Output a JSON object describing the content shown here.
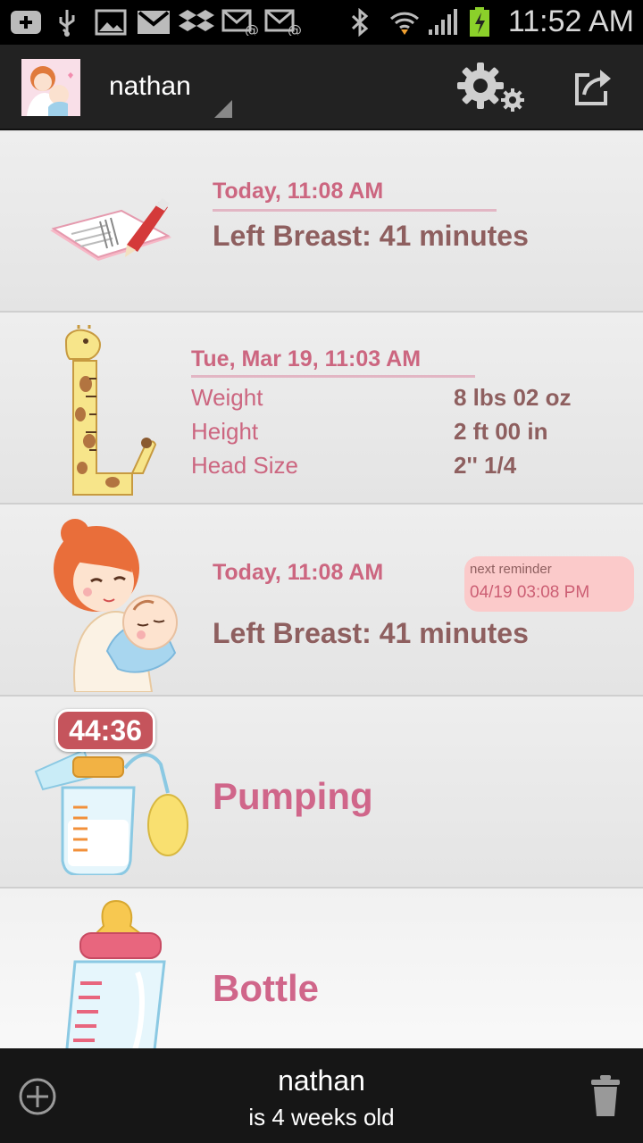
{
  "status_bar": {
    "time": "11:52 AM",
    "icons": [
      "add-notification-icon",
      "usb-icon",
      "image-icon",
      "gmail-icon",
      "dropbox-icon",
      "email-icon",
      "email-icon",
      "bluetooth-icon",
      "wifi-icon",
      "signal-icon",
      "battery-charging-icon"
    ]
  },
  "header": {
    "user_name": "nathan",
    "icons": [
      "avatar-image",
      "settings-gear-icon",
      "share-icon"
    ]
  },
  "entries": [
    {
      "type": "diary",
      "icon": "notebook-pen-icon",
      "date": "Today, 11:08 AM",
      "summary": "Left Breast: 41 minutes"
    },
    {
      "type": "growth",
      "icon": "giraffe-ruler-icon",
      "date": "Tue, Mar 19, 11:03 AM",
      "measurements": [
        {
          "label": "Weight",
          "value": "8 lbs 02 oz"
        },
        {
          "label": "Height",
          "value": "2 ft 00 in"
        },
        {
          "label": "Head Size",
          "value": "2'' 1/4"
        }
      ]
    },
    {
      "type": "breastfeeding",
      "icon": "mother-nursing-icon",
      "date": "Today, 11:08 AM",
      "summary": "Left Breast: 41 minutes",
      "reminder_label": "next reminder",
      "reminder_time": "04/19 03:08 PM"
    },
    {
      "type": "pumping",
      "icon": "breast-pump-icon",
      "timer": "44:36",
      "label": "Pumping"
    },
    {
      "type": "bottle",
      "icon": "baby-bottle-icon",
      "label": "Bottle"
    }
  ],
  "footer": {
    "name": "nathan",
    "age": "is 4 weeks old"
  },
  "colors": {
    "accent_pink": "#d0668a",
    "text_brown": "#8e5f5f",
    "reminder_bg": "#fbcaca",
    "timer_badge": "#c5545c"
  }
}
